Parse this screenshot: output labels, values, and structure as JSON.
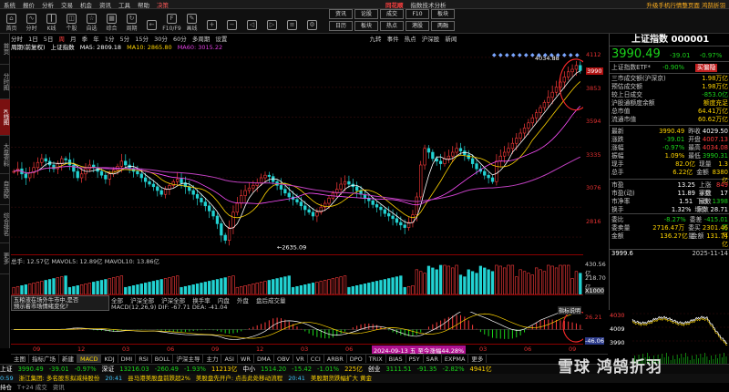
{
  "menubar": {
    "items": [
      "系统",
      "报价",
      "分析",
      "交易",
      "机会",
      "资讯",
      "工具",
      "帮助",
      "决策"
    ],
    "brand": "同花顺",
    "center": "指数技术分析",
    "right": "升级手机行情整页面 鸿鹄折羽"
  },
  "toolbar": {
    "buttons": [
      "首页",
      "分时",
      "K线",
      "个股",
      "自选",
      "综合",
      "周期",
      "",
      "F10/F9",
      "画线",
      "",
      "",
      "",
      "",
      "",
      ""
    ],
    "group1": [
      "资讯",
      "论股",
      "成交",
      "",
      "F10",
      "板块"
    ],
    "group2": [
      "日历",
      "板块",
      "热点",
      "",
      "港股",
      "两融"
    ]
  },
  "left_tabs": [
    "首页",
    "分时图",
    "K线图",
    "大盘资料",
    "自选股",
    "综合排名",
    "更多"
  ],
  "chart_header": {
    "periods": [
      "分时",
      "1日",
      "5日",
      "周",
      "月",
      "季",
      "年",
      "1分",
      "5分",
      "15分",
      "30分",
      "60分",
      "多周期",
      "设置"
    ],
    "title_line": "上证指数",
    "ma5": "MA5: 2809.18",
    "ma10": "MA10: 2865.80",
    "ma60": "MA60: 3015.22",
    "period_label": "周期(前复权)",
    "right_tabs": [
      "九转",
      "事件",
      "热点",
      "沪深股",
      "新闻"
    ]
  },
  "price_axis": [
    "4112",
    "3990",
    "3853",
    "3594",
    "3335",
    "3076",
    "2816"
  ],
  "price_labels": {
    "high": "4034.88",
    "low": "2635.09"
  },
  "volume": {
    "header": "总手: 12.57亿   MAVOL5: 12.89亿   MAVOL10: 13.86亿",
    "axis": [
      "430.56亿",
      "218.70亿",
      "X1000"
    ]
  },
  "substrip": [
    "全部",
    "沪深全部",
    "沪深全部",
    "换手率",
    "内盘",
    "外盘",
    "盘后成交量"
  ],
  "popup": {
    "line1": "五粮液在场外牛市中,是否",
    "line2": "预示着市场情绪变化?"
  },
  "macd": {
    "header": "MACD(12,26,9) DIF: -67.71  DEA: -41.04",
    "axis": [
      "26.21",
      "-46.06"
    ],
    "badge": "指标说明"
  },
  "xaxis": [
    "09",
    "12",
    "03",
    "06",
    "09",
    "12",
    "03",
    "06",
    "09",
    "12",
    "03",
    "06",
    "09"
  ],
  "xaxis_note": "2024-09-13 五 至今涨幅44.28%",
  "ind_tabs": [
    "主图",
    "指标广场",
    "新建",
    "MACD",
    "KDJ",
    "DMI",
    "RSI",
    "BOLL",
    "沪深主导",
    "主力",
    "ASI",
    "WR",
    "DMA",
    "OBV",
    "VR",
    "CCI",
    "ARBR",
    "DPO",
    "TRIX",
    "BIAS",
    "PSY",
    "SAR",
    "EXPMA",
    "更多"
  ],
  "quote": {
    "title": "上证指数 000001",
    "price": "3990.49",
    "chg": "-39.01",
    "pct": "-0.97%",
    "etf_label": "上证指数ETF*",
    "etf_pct": "-0.90%",
    "etf_tag": "买偏隐",
    "rows1": [
      {
        "k": "三市成交额(沪深京)",
        "v": "1.98万亿"
      },
      {
        "k": "预估成交额",
        "v": "1.98万亿"
      },
      {
        "k": "较上日成交",
        "v": "-853.0亿"
      },
      {
        "k": "沪股通额度余额",
        "v": "额度充足"
      },
      {
        "k": "总市值",
        "v": "64.41万亿"
      },
      {
        "k": "流通市值",
        "v": "60.62万亿"
      }
    ],
    "rows2": [
      {
        "k": "最新",
        "v": "3990.49",
        "k2": "昨收",
        "v2": "4029.50"
      },
      {
        "k": "涨跌",
        "v": "-39.01",
        "k2": "开盘",
        "v2": "4007.13"
      },
      {
        "k": "涨幅",
        "v": "-0.97%",
        "k2": "最高",
        "v2": "4034.08"
      },
      {
        "k": "振幅",
        "v": "1.09%",
        "k2": "最低",
        "v2": "3990.31"
      },
      {
        "k": "现手",
        "v": "82.0亿",
        "k2": "现量",
        "v2": "1.3"
      },
      {
        "k": "总手",
        "v": "6.22亿",
        "k2": "金额",
        "v2": "8380亿"
      }
    ],
    "rows3": [
      {
        "k": "市盈",
        "v": "13.25",
        "k2": "上涨家数",
        "v2": "849"
      },
      {
        "k": "市盈(动)",
        "v": "11.89",
        "k2": "平盘家数",
        "v2": "17"
      },
      {
        "k": "市净率",
        "v": "1.51",
        "k2": "下跌家数",
        "v2": "1398"
      },
      {
        "k": "换手",
        "v": "1.32%",
        "k2": "均价",
        "v2": "28.71"
      }
    ],
    "rows4": [
      {
        "k": "委比",
        "v": "-8.27%",
        "k2": "委差",
        "v2": "-415.01万"
      },
      {
        "k": "委卖量",
        "v": "2716.47万",
        "k2": "委买量",
        "v2": "2301.46万"
      },
      {
        "k": "金额",
        "v": "136.27亿",
        "k2": "金额",
        "v2": "131.74亿"
      }
    ],
    "mini_axis": [
      "4030",
      "4009",
      "3990"
    ],
    "time_label": "2025-11-14",
    "wavg": "3999.6"
  },
  "status": {
    "row1": [
      {
        "t": "上证",
        "c": "white"
      },
      {
        "t": "3990.49",
        "c": "green"
      },
      {
        "t": "-39.01",
        "c": "green"
      },
      {
        "t": "-0.97%",
        "c": "green"
      },
      {
        "t": "深证",
        "c": "white"
      },
      {
        "t": "13216.03",
        "c": "green"
      },
      {
        "t": "-260.49",
        "c": "green"
      },
      {
        "t": "-1.93%",
        "c": "green"
      },
      {
        "t": "11213亿",
        "c": "yel"
      },
      {
        "t": "中小",
        "c": "white"
      },
      {
        "t": "1514.20",
        "c": "green"
      },
      {
        "t": "-15.42",
        "c": "green"
      },
      {
        "t": "-1.01%",
        "c": "green"
      },
      {
        "t": "225亿",
        "c": "yel"
      },
      {
        "t": "创业",
        "c": "white"
      },
      {
        "t": "3111.51",
        "c": "green"
      },
      {
        "t": "-91.35",
        "c": "green"
      },
      {
        "t": "-2.82%",
        "c": "green"
      },
      {
        "t": "4941亿",
        "c": "yel"
      }
    ],
    "row2": [
      {
        "t": "0:59",
        "c": "cyan"
      },
      {
        "t": "浙江集团: 多名股东拟减持股份",
        "c": "yel"
      },
      {
        "t": "20:41",
        "c": "cyan"
      },
      {
        "t": "县马港美股盘前跌超2%",
        "c": "yel"
      },
      {
        "t": "美股盘先开户: 点击此处移动流程",
        "c": "yel"
      },
      {
        "t": "20:41",
        "c": "cyan"
      },
      {
        "t": "美股期货跌幅扩大 黄金",
        "c": "yel"
      }
    ],
    "row3": [
      {
        "t": "持仓",
        "c": "white"
      },
      {
        "t": "T+24 成交",
        "c": "gray"
      },
      {
        "t": "资讯",
        "c": "gray"
      }
    ]
  },
  "watermark": "雪球 鸿鹄折羽",
  "colors": {
    "up": "#ff3b3b",
    "down": "#1bd41b",
    "ma5": "#ffffff",
    "ma10": "#ffd400",
    "ma60": "#c040c0",
    "ma20": "#ff4fff",
    "accent": "#ff8c00"
  }
}
